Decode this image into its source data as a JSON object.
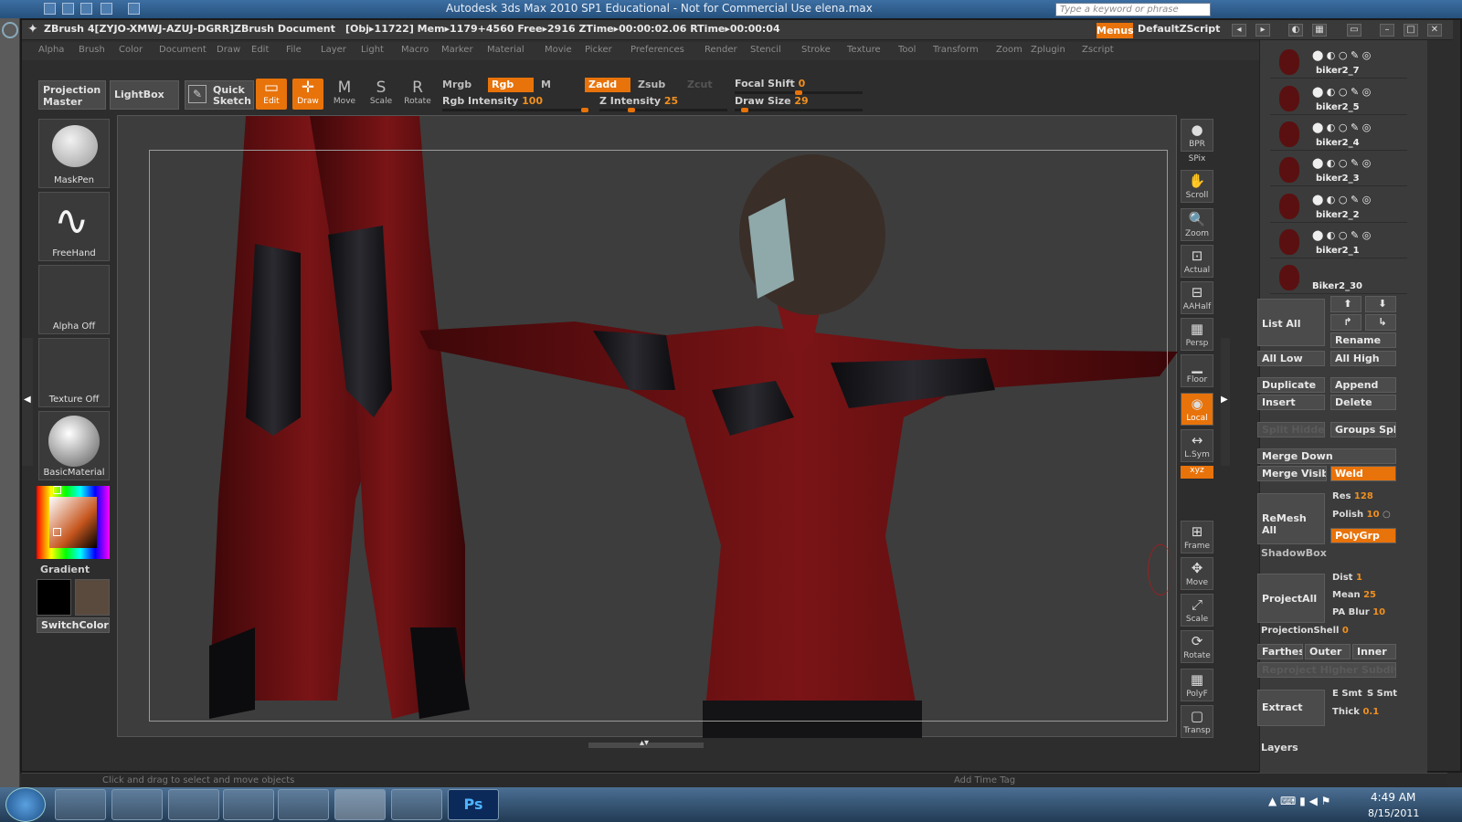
{
  "max_window": {
    "title": "Autodesk 3ds Max  2010 SP1   Educational - Not for Commercial Use      elena.max",
    "search_placeholder": "Type a keyword or phrase"
  },
  "zbrush": {
    "title": "ZBrush 4[ZYJO-XMWJ-AZUJ-DGRR]",
    "document": "ZBrush Document",
    "obj_info": "[Obj▸11722] Mem▸1179+4560  Free▸2916  ZTime▸00:00:02.06  RTime▸00:00:04",
    "menus_label": "Menus",
    "script_label": "DefaultZScript"
  },
  "menubar": [
    "Alpha",
    "Brush",
    "Color",
    "Document",
    "Draw",
    "Edit",
    "File",
    "Layer",
    "Light",
    "Macro",
    "Marker",
    "Material",
    "Movie",
    "Picker",
    "Preferences",
    "Render",
    "Stencil",
    "Stroke",
    "Texture",
    "Tool",
    "Transform",
    "Zoom",
    "Zplugin",
    "Zscript"
  ],
  "shelf": {
    "projection_master": "Projection Master",
    "lightbox": "LightBox",
    "quick_sketch": "Quick Sketch",
    "tools": [
      {
        "label": "Edit",
        "glyph": "▭",
        "on": true
      },
      {
        "label": "Draw",
        "glyph": "✛",
        "on": true
      },
      {
        "label": "Move",
        "glyph": "M",
        "on": false
      },
      {
        "label": "Scale",
        "glyph": "S",
        "on": false
      },
      {
        "label": "Rotate",
        "glyph": "R",
        "on": false
      }
    ],
    "mrgb": "Mrgb",
    "rgb": "Rgb",
    "m": "M",
    "zadd": "Zadd",
    "zsub": "Zsub",
    "zcut": "Zcut",
    "rgb_intensity_label": "Rgb Intensity",
    "rgb_intensity": "100",
    "z_intensity_label": "Z Intensity",
    "z_intensity": "25",
    "focal_shift_label": "Focal Shift",
    "focal_shift": "0",
    "draw_size_label": "Draw Size",
    "draw_size": "29",
    "rgb_intensity_level": 1.0,
    "z_intensity_level": 0.25,
    "focal_shift_level": 0.5,
    "draw_size_level": 0.08
  },
  "left_tray": {
    "brush": "MaskPen",
    "stroke": "FreeHand",
    "alpha": "Alpha Off",
    "texture": "Texture Off",
    "material": "BasicMaterial",
    "gradient": "Gradient",
    "switch_color": "SwitchColor"
  },
  "right_toolbar": [
    {
      "label": "BPR",
      "glyph": "●"
    },
    {
      "label": "SPix",
      "glyph": ""
    },
    {
      "label": "Scroll",
      "glyph": "✋"
    },
    {
      "label": "Zoom",
      "glyph": "🔍"
    },
    {
      "label": "Actual",
      "glyph": "⊡"
    },
    {
      "label": "AAHalf",
      "glyph": "⊟"
    },
    {
      "label": "Persp",
      "glyph": "▦"
    },
    {
      "label": "Floor",
      "glyph": "▁"
    },
    {
      "label": "Local",
      "glyph": "◉"
    },
    {
      "label": "L.Sym",
      "glyph": "↔"
    },
    {
      "label": "xyz",
      "glyph": ""
    },
    {
      "label": "Frame",
      "glyph": "⊞"
    },
    {
      "label": "Move",
      "glyph": "✥"
    },
    {
      "label": "Scale",
      "glyph": "⤢"
    },
    {
      "label": "Rotate",
      "glyph": "⟳"
    },
    {
      "label": "PolyF",
      "glyph": "▦"
    },
    {
      "label": "Transp",
      "glyph": "▢"
    }
  ],
  "subtools": [
    "biker2_7",
    "biker2_5",
    "biker2_4",
    "biker2_3",
    "biker2_2",
    "biker2_1",
    "Biker2_30"
  ],
  "right_panel": {
    "list_all": "List  All",
    "rename": "Rename",
    "all_low": "All Low",
    "all_high": "All High",
    "duplicate": "Duplicate",
    "append": "Append",
    "insert": "Insert",
    "delete": "Delete",
    "split_hidden": "Split Hidden",
    "groups_split": "Groups Split",
    "merge_down": "Merge Down",
    "merge_visible": "Merge Visible",
    "weld": "Weld",
    "remesh_all": "ReMesh  All",
    "res_label": "Res",
    "res": "128",
    "polish_label": "Polish",
    "polish": "10",
    "polygrp": "PolyGrp",
    "shadowbox": "ShadowBox",
    "project_all": "ProjectAll",
    "dist_label": "Dist",
    "dist": "1",
    "mean_label": "Mean",
    "mean": "25",
    "pa_blur_label": "PA Blur",
    "pa_blur": "10",
    "projection_shell_label": "ProjectionShell",
    "projection_shell": "0",
    "farthest": "Farthest",
    "outer": "Outer",
    "inner": "Inner",
    "reproject": "Reproject Higher Subdiv",
    "extract": "Extract",
    "e_smt": "E Smt",
    "s_smt": "S Smt",
    "thick_label": "Thick",
    "thick": "0.1",
    "layers": "Layers"
  },
  "status": {
    "text": "Click and drag to select and move objects",
    "add_time_tag": "Add Time Tag"
  },
  "taskbar": {
    "time": "4:49 AM",
    "date": "8/15/2011"
  },
  "colors": {
    "accent": "#e8730a",
    "suit_red": "#6e0f10",
    "suit_black": "#1a1a1e"
  }
}
